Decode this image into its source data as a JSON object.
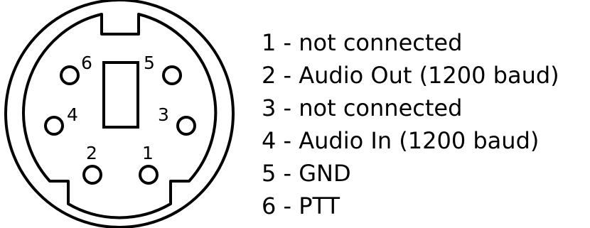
{
  "connector": {
    "pin_labels": [
      "6",
      "5",
      "4",
      "3",
      "2",
      "1"
    ]
  },
  "legend": {
    "separator": " - ",
    "items": [
      {
        "pin": "1",
        "description": "not connected"
      },
      {
        "pin": "2",
        "description": "Audio Out (1200 baud)"
      },
      {
        "pin": "3",
        "description": "not connected"
      },
      {
        "pin": "4",
        "description": "Audio In (1200 baud)"
      },
      {
        "pin": "5",
        "description": "GND"
      },
      {
        "pin": "6",
        "description": "PTT"
      }
    ]
  }
}
